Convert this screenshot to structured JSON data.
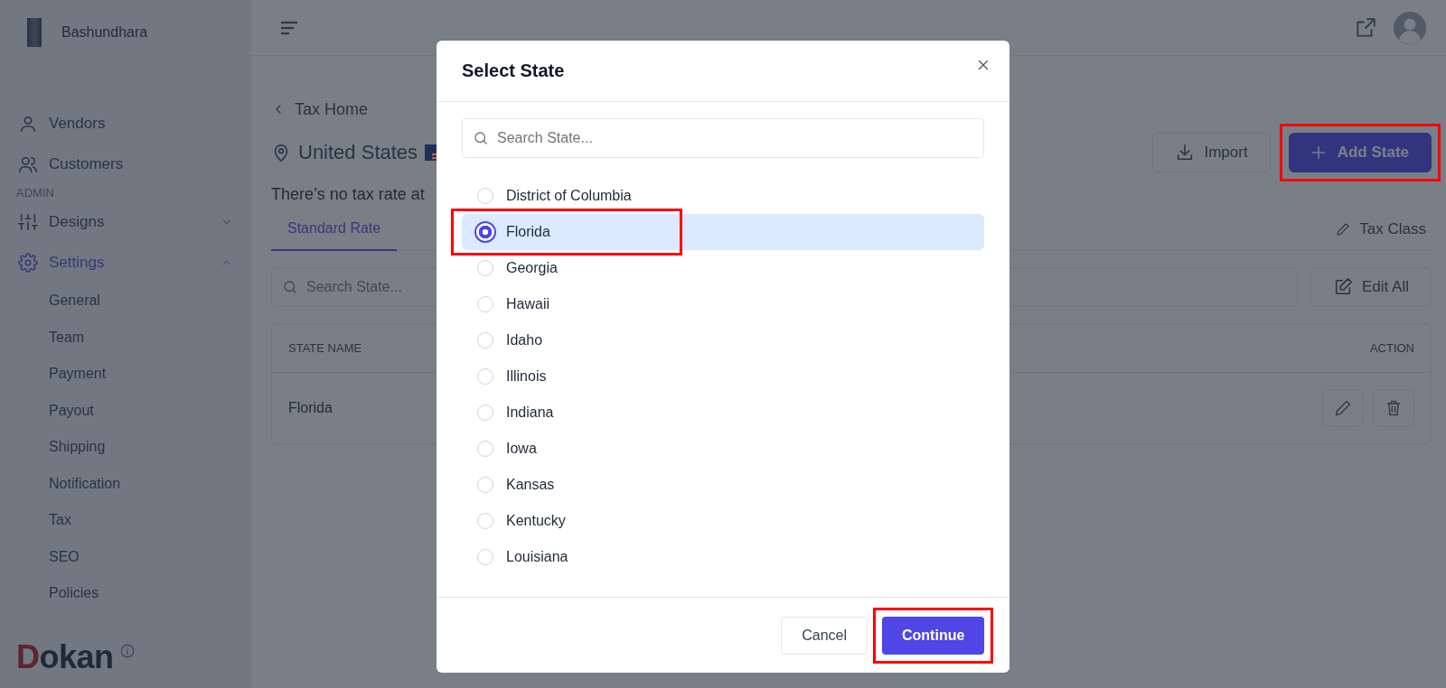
{
  "sidebar": {
    "brand": "Bashundhara",
    "items": [
      {
        "label": "Vendors",
        "kind": "user",
        "selected": false
      },
      {
        "label": "Customers",
        "kind": "users",
        "selected": false
      }
    ],
    "section_label": "ADMIN",
    "admin_items": [
      {
        "label": "Designs",
        "kind": "sliders",
        "selected": false,
        "expanded": false
      },
      {
        "label": "Settings",
        "kind": "gear",
        "selected": true,
        "expanded": true,
        "children": [
          {
            "label": "General",
            "selected": false
          },
          {
            "label": "Team",
            "selected": false
          },
          {
            "label": "Payment",
            "selected": false
          },
          {
            "label": "Payout",
            "selected": false
          },
          {
            "label": "Shipping",
            "selected": false
          },
          {
            "label": "Notification",
            "selected": false
          },
          {
            "label": "Tax",
            "selected": false
          },
          {
            "label": "SEO",
            "selected": false
          },
          {
            "label": "Policies",
            "selected": false
          }
        ]
      }
    ],
    "logo": "Dokan"
  },
  "page": {
    "back_link": "Tax Home",
    "country": "United States",
    "notice": "There’s no tax rate at",
    "buttons": [
      {
        "label": "Import",
        "kind": "import"
      },
      {
        "label": "Add State",
        "kind": "add",
        "highlighted": true
      }
    ],
    "tabs": [
      {
        "label": "Standard Rate",
        "selected": true
      }
    ],
    "tax_class_link": "Tax Class",
    "search": {
      "placeholder": "Search State..."
    },
    "edit_all": "Edit All",
    "table": {
      "columns": [
        "STATE NAME",
        "ACTION"
      ],
      "rows": [
        {
          "state": "Florida"
        }
      ]
    }
  },
  "modal": {
    "title": "Select State",
    "search": {
      "placeholder": "Search State..."
    },
    "options": [
      {
        "label": "District of Columbia",
        "selected": false,
        "highlighted": false
      },
      {
        "label": "Florida",
        "selected": true,
        "highlighted": true
      },
      {
        "label": "Georgia",
        "selected": false,
        "highlighted": false
      },
      {
        "label": "Hawaii",
        "selected": false,
        "highlighted": false
      },
      {
        "label": "Idaho",
        "selected": false,
        "highlighted": false
      },
      {
        "label": "Illinois",
        "selected": false,
        "highlighted": false
      },
      {
        "label": "Indiana",
        "selected": false,
        "highlighted": false
      },
      {
        "label": "Iowa",
        "selected": false,
        "highlighted": false
      },
      {
        "label": "Kansas",
        "selected": false,
        "highlighted": false
      },
      {
        "label": "Kentucky",
        "selected": false,
        "highlighted": false
      },
      {
        "label": "Louisiana",
        "selected": false,
        "highlighted": false
      }
    ],
    "buttons": [
      {
        "label": "Cancel",
        "kind": "secondary"
      },
      {
        "label": "Continue",
        "kind": "primary",
        "highlighted": true
      }
    ]
  }
}
